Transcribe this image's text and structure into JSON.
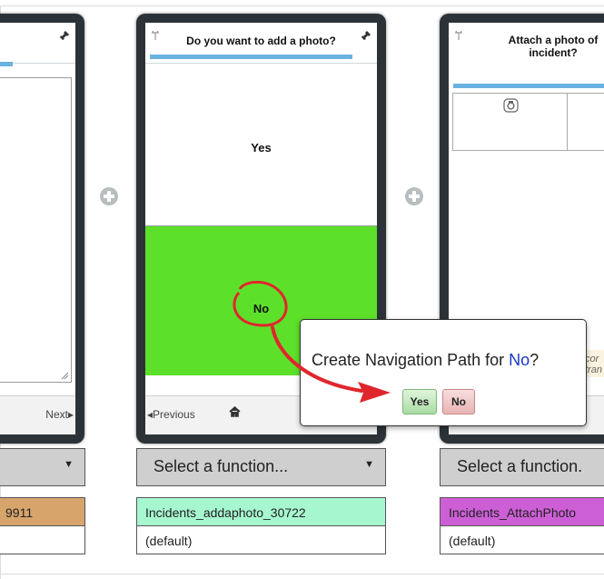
{
  "screens": {
    "left": {
      "foot_next": "Next▸"
    },
    "middle": {
      "title": "Do you want to add a photo?",
      "option_yes": "Yes",
      "option_no": "No",
      "foot_previous": "◂Previous"
    },
    "right": {
      "title_line1": "Attach a photo of",
      "title_line2": "incident?",
      "hint_line1": "cor",
      "hint_line2": "tran"
    }
  },
  "functions": {
    "left": {
      "row1": "9911"
    },
    "middle": {
      "select_label": "Select a function...",
      "row1": "Incidents_addaphoto_30722",
      "row2": "(default)"
    },
    "right": {
      "select_label": "Select a function.",
      "row1": "Incidents_AttachPhoto",
      "row2": "(default)"
    }
  },
  "popup": {
    "question_prefix": "Create Navigation Path for ",
    "question_target": "No",
    "question_suffix": "?",
    "yes_label": "Yes",
    "no_label": "No"
  },
  "colors": {
    "no_option_bg": "#5de02a",
    "row_left_bg": "#d7a46c",
    "row_middle_bg": "#a6f7cf",
    "row_right_bg": "#cd5fd6",
    "annotation_red": "#e0262d",
    "highlight_blue": "#1a37c7"
  },
  "icons": {
    "pin": "pin-icon",
    "plug": "plug-icon",
    "home": "home-icon",
    "camera": "camera-icon",
    "add": "plus-circle-icon"
  }
}
